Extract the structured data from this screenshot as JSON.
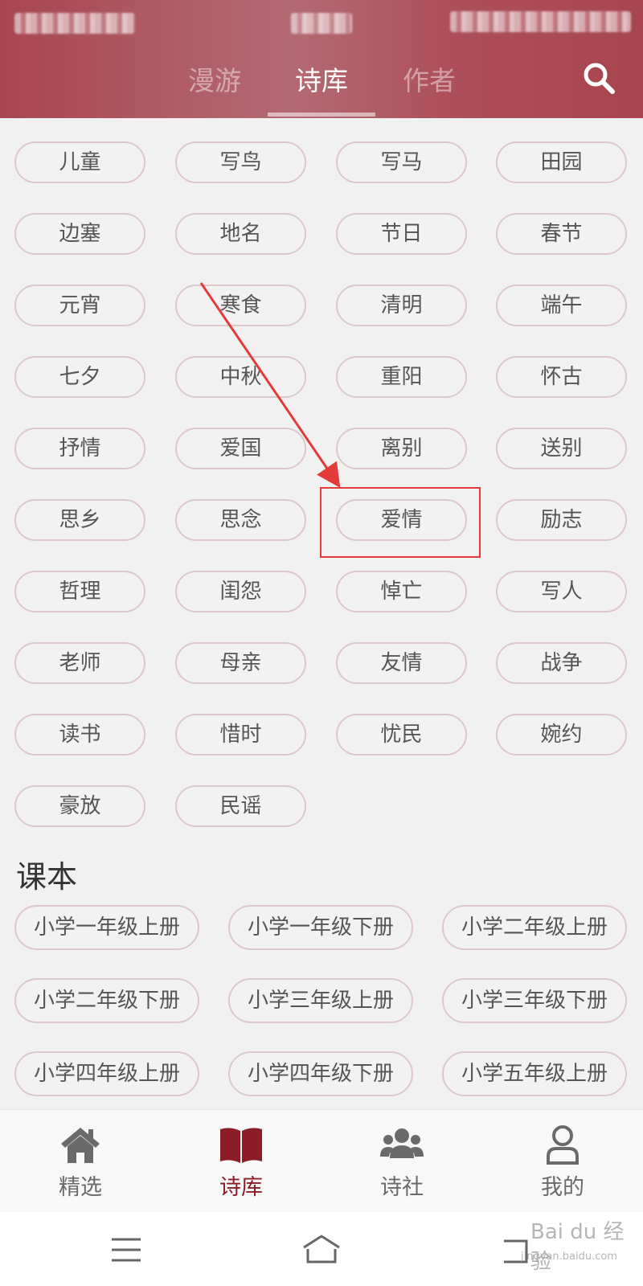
{
  "header": {
    "tabs": [
      {
        "label": "漫游",
        "active": false
      },
      {
        "label": "诗库",
        "active": true
      },
      {
        "label": "作者",
        "active": false
      }
    ],
    "search_icon": "search-icon"
  },
  "categories": [
    "儿童",
    "写鸟",
    "写马",
    "田园",
    "边塞",
    "地名",
    "节日",
    "春节",
    "元宵",
    "寒食",
    "清明",
    "端午",
    "七夕",
    "中秋",
    "重阳",
    "怀古",
    "抒情",
    "爱国",
    "离别",
    "送别",
    "思乡",
    "思念",
    "爱情",
    "励志",
    "哲理",
    "闺怨",
    "悼亡",
    "写人",
    "老师",
    "母亲",
    "友情",
    "战争",
    "读书",
    "惜时",
    "忧民",
    "婉约",
    "豪放",
    "民谣"
  ],
  "highlighted_category": "爱情",
  "textbook": {
    "title": "课本",
    "items": [
      "小学一年级上册",
      "小学一年级下册",
      "小学二年级上册",
      "小学二年级下册",
      "小学三年级上册",
      "小学三年级下册",
      "小学四年级上册",
      "小学四年级下册",
      "小学五年级上册"
    ]
  },
  "bottom_nav": [
    {
      "label": "精选",
      "icon": "home-icon",
      "active": false
    },
    {
      "label": "诗库",
      "icon": "book-icon",
      "active": true
    },
    {
      "label": "诗社",
      "icon": "group-icon",
      "active": false
    },
    {
      "label": "我的",
      "icon": "user-icon",
      "active": false
    }
  ],
  "system_nav": {
    "icons": [
      "menu-icon",
      "home-outline-icon",
      "back-icon"
    ]
  },
  "watermark": {
    "main": "Bai du 经验",
    "sub": "jingyan.baidu.com"
  },
  "colors": {
    "accent": "#a8464f",
    "active_nav": "#8c1c26",
    "pill_border": "#dcc8cb",
    "annotation": "#e33a3a"
  }
}
